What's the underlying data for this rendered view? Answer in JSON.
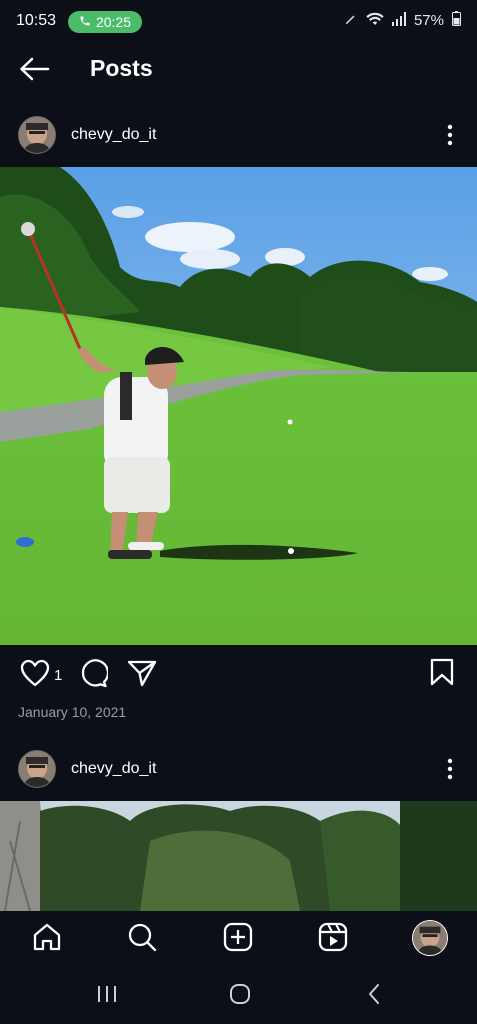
{
  "status_bar": {
    "time": "10:53",
    "call_time": "20:25",
    "battery": "57%"
  },
  "header": {
    "title": "Posts",
    "back_icon": "arrow-left-icon"
  },
  "posts": [
    {
      "username": "chevy_do_it",
      "likes": "1",
      "date": "January 10, 2021"
    },
    {
      "username": "chevy_do_it"
    }
  ],
  "bottom_nav": {
    "items": [
      "home-icon",
      "search-icon",
      "add-post-icon",
      "reels-icon",
      "profile-avatar"
    ]
  },
  "system_nav": {
    "items": [
      "recents-icon",
      "home-circle-icon",
      "back-chevron-icon"
    ]
  },
  "colors": {
    "background": "#0c0f17",
    "call_pill": "#4cbb6a",
    "grass": "#6fc13a",
    "sky": "#7fb6e6"
  }
}
